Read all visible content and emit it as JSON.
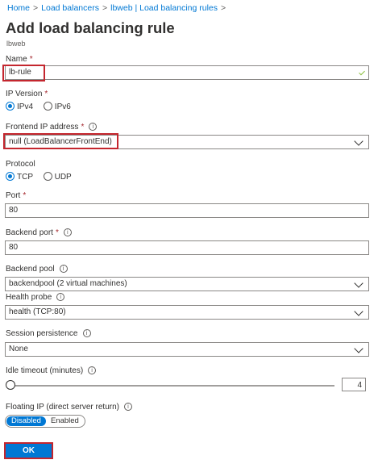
{
  "breadcrumb": {
    "items": [
      "Home",
      "Load balancers",
      "lbweb | Load balancing rules"
    ],
    "separator": ">"
  },
  "page": {
    "title": "Add load balancing rule",
    "subtitle": "lbweb"
  },
  "form": {
    "name": {
      "label": "Name",
      "required_mark": "*",
      "value": "lb-rule"
    },
    "ip_version": {
      "label": "IP Version",
      "required_mark": "*",
      "options": [
        "IPv4",
        "IPv6"
      ],
      "selected": "IPv4"
    },
    "frontend_ip": {
      "label": "Frontend IP address",
      "required_mark": "*",
      "value": "null (LoadBalancerFrontEnd)"
    },
    "protocol": {
      "label": "Protocol",
      "options": [
        "TCP",
        "UDP"
      ],
      "selected": "TCP"
    },
    "port": {
      "label": "Port",
      "required_mark": "*",
      "value": "80"
    },
    "backend_port": {
      "label": "Backend port",
      "required_mark": "*",
      "value": "80"
    },
    "backend_pool": {
      "label": "Backend pool",
      "value": "backendpool (2 virtual machines)"
    },
    "health_probe": {
      "label": "Health probe",
      "value": "health (TCP:80)"
    },
    "session_persistence": {
      "label": "Session persistence",
      "value": "None"
    },
    "idle_timeout": {
      "label": "Idle timeout (minutes)",
      "value": "4",
      "slider_level": 0
    },
    "floating_ip": {
      "label": "Floating IP (direct server return)",
      "options": [
        "Disabled",
        "Enabled"
      ],
      "selected": "Disabled"
    }
  },
  "actions": {
    "ok_label": "OK"
  },
  "icons": {
    "info": "info-icon",
    "chevron": "chevron-down-icon",
    "valid": "checkmark-icon",
    "info_glyph": "i"
  },
  "colors": {
    "accent": "#0078d4",
    "highlight_box": "#c4262e",
    "required": "#a4262c",
    "valid": "#8cbf3f"
  }
}
